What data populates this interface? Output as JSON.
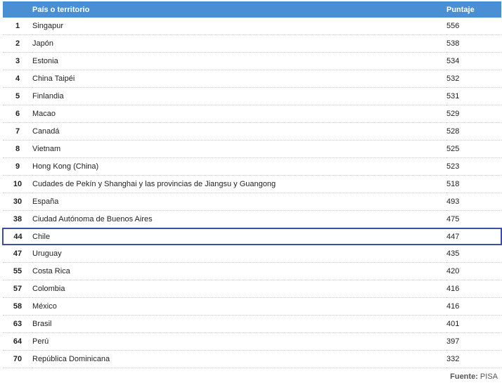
{
  "table": {
    "headers": {
      "rank": "",
      "country": "País o territorio",
      "score": "Puntaje"
    },
    "rows": [
      {
        "rank": "1",
        "country": "Singapur",
        "score": "556"
      },
      {
        "rank": "2",
        "country": "Japón",
        "score": "538"
      },
      {
        "rank": "3",
        "country": "Estonia",
        "score": "534"
      },
      {
        "rank": "4",
        "country": "China Taipéi",
        "score": "532"
      },
      {
        "rank": "5",
        "country": "Finlandia",
        "score": "531"
      },
      {
        "rank": "6",
        "country": "Macao",
        "score": "529"
      },
      {
        "rank": "7",
        "country": "Canadá",
        "score": "528"
      },
      {
        "rank": "8",
        "country": "Vietnam",
        "score": "525"
      },
      {
        "rank": "9",
        "country": "Hong Kong (China)",
        "score": "523"
      },
      {
        "rank": "10",
        "country": "Cudades de Pekín y Shanghai y las provincias de Jiangsu y Guangong",
        "score": "518"
      },
      {
        "rank": "30",
        "country": "España",
        "score": "493"
      },
      {
        "rank": "38",
        "country": "Ciudad Autónoma de Buenos Aires",
        "score": "475"
      },
      {
        "rank": "44",
        "country": "Chile",
        "score": "447",
        "highlight": true
      },
      {
        "rank": "47",
        "country": "Uruguay",
        "score": "435"
      },
      {
        "rank": "55",
        "country": "Costa Rica",
        "score": "420"
      },
      {
        "rank": "57",
        "country": "Colombia",
        "score": "416"
      },
      {
        "rank": "58",
        "country": "México",
        "score": "416"
      },
      {
        "rank": "63",
        "country": "Brasil",
        "score": "401"
      },
      {
        "rank": "64",
        "country": "Perú",
        "score": "397"
      },
      {
        "rank": "70",
        "country": "República Dominicana",
        "score": "332"
      }
    ]
  },
  "source": {
    "label": "Fuente:",
    "value": "PISA"
  },
  "colors": {
    "header_bg": "#4a8fd4",
    "rank_text": "#3f6fa8",
    "highlight_border": "#3a4ea6"
  }
}
